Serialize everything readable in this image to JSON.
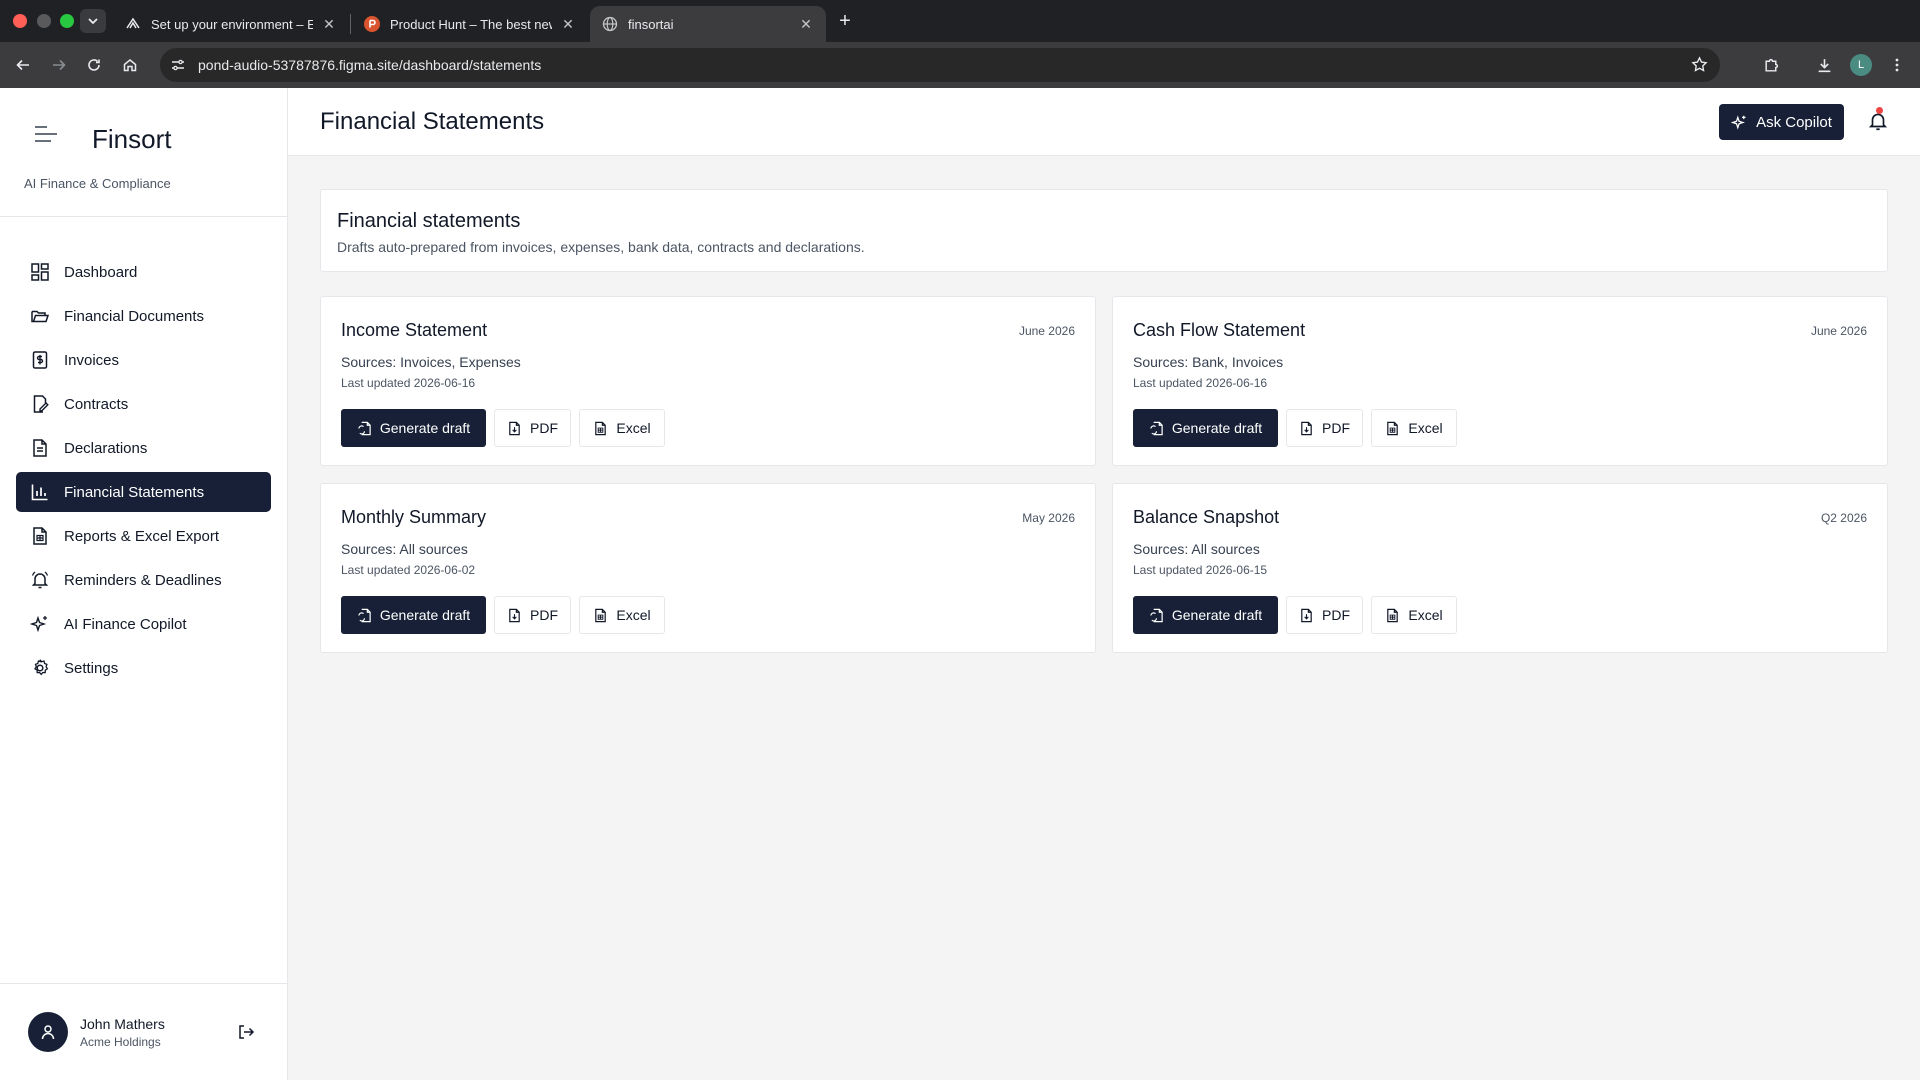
{
  "browser": {
    "tabs": [
      {
        "title": "Set up your environment – Ex",
        "close": "✕"
      },
      {
        "title": "Product Hunt – The best new",
        "close": "✕"
      },
      {
        "title": "finsortai",
        "close": "✕"
      }
    ],
    "new_tab": "+",
    "url": "pond-audio-53787876.figma.site/dashboard/statements",
    "profile_initial": "L"
  },
  "sidebar": {
    "brand": "Finsort",
    "tagline": "AI Finance & Compliance",
    "items": [
      {
        "label": "Dashboard",
        "icon": "dashboard-icon"
      },
      {
        "label": "Financial Documents",
        "icon": "folder-icon"
      },
      {
        "label": "Invoices",
        "icon": "invoice-icon"
      },
      {
        "label": "Contracts",
        "icon": "contract-icon"
      },
      {
        "label": "Declarations",
        "icon": "declaration-icon"
      },
      {
        "label": "Financial Statements",
        "icon": "chart-icon",
        "active": true
      },
      {
        "label": "Reports & Excel Export",
        "icon": "spreadsheet-icon"
      },
      {
        "label": "Reminders & Deadlines",
        "icon": "bell-icon"
      },
      {
        "label": "AI Finance Copilot",
        "icon": "sparkles-icon"
      },
      {
        "label": "Settings",
        "icon": "gear-icon"
      }
    ],
    "user": {
      "name": "John Mathers",
      "org": "Acme Holdings"
    }
  },
  "header": {
    "title": "Financial Statements",
    "ask_label": "Ask Copilot"
  },
  "intro": {
    "title": "Financial statements",
    "description": "Drafts auto-prepared from invoices, expenses, bank data, contracts and declarations."
  },
  "cards": [
    {
      "title": "Income Statement",
      "period": "June 2026",
      "sources": "Sources: Invoices, Expenses",
      "updated": "Last updated 2026-06-16"
    },
    {
      "title": "Cash Flow Statement",
      "period": "June 2026",
      "sources": "Sources: Bank, Invoices",
      "updated": "Last updated 2026-06-16"
    },
    {
      "title": "Monthly Summary",
      "period": "May 2026",
      "sources": "Sources: All sources",
      "updated": "Last updated 2026-06-02"
    },
    {
      "title": "Balance Snapshot",
      "period": "Q2 2026",
      "sources": "Sources: All sources",
      "updated": "Last updated 2026-06-15"
    }
  ],
  "actions": {
    "generate": "Generate draft",
    "pdf": "PDF",
    "excel": "Excel"
  },
  "colors": {
    "primary": "#172036",
    "notification": "#ef4444",
    "background": "#f4f4f5"
  }
}
